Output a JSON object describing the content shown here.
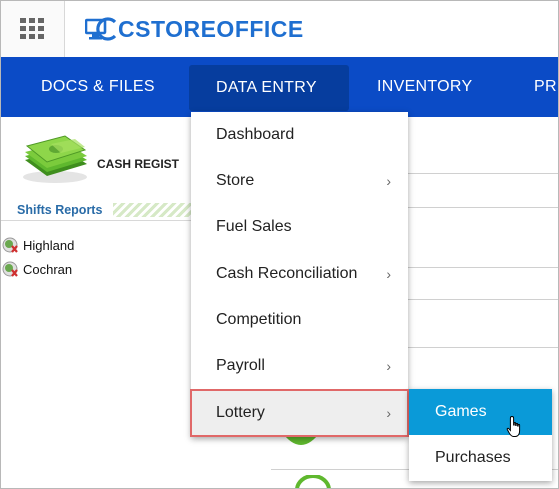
{
  "header": {
    "logo_text": "CSTOREOFFICE"
  },
  "nav": {
    "items": [
      {
        "label": "DOCS & FILES"
      },
      {
        "label": "DATA ENTRY"
      },
      {
        "label": "INVENTORY"
      },
      {
        "label": "PR"
      }
    ],
    "active_index": 1
  },
  "page": {
    "section_title": "CASH REGIST",
    "shifts_label": "Shifts Reports",
    "stores": [
      "Highland",
      "Cochran"
    ]
  },
  "dropdown": {
    "items": [
      {
        "label": "Dashboard",
        "has_submenu": false
      },
      {
        "label": "Store",
        "has_submenu": true
      },
      {
        "label": "Fuel Sales",
        "has_submenu": false
      },
      {
        "label": "Cash Reconciliation",
        "has_submenu": true
      },
      {
        "label": "Competition",
        "has_submenu": false
      },
      {
        "label": "Payroll",
        "has_submenu": true
      },
      {
        "label": "Lottery",
        "has_submenu": true
      }
    ],
    "highlighted_index": 6
  },
  "submenu": {
    "items": [
      {
        "label": "Games"
      },
      {
        "label": "Purchases"
      }
    ],
    "active_index": 0
  },
  "colors": {
    "nav_bg": "#0b4bc6",
    "nav_active": "#063d9e",
    "submenu_active": "#0a9ad8",
    "highlight_border": "#e06868",
    "logo": "#1f6fd0"
  }
}
